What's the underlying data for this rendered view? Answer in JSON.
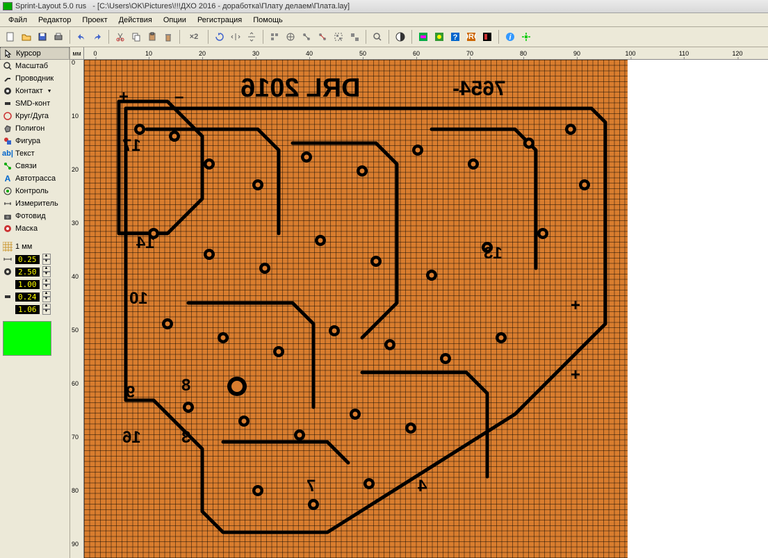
{
  "title": {
    "app": "Sprint-Layout 5.0 rus",
    "file": "- [C:\\Users\\OK\\Pictures\\!!!ДХО 2016 - доработка\\Плату делаем\\Плата.lay]"
  },
  "menu": [
    "Файл",
    "Редактор",
    "Проект",
    "Действия",
    "Опции",
    "Регистрация",
    "Помощь"
  ],
  "tools": [
    {
      "id": "cursor",
      "label": "Курсор",
      "selected": true
    },
    {
      "id": "zoom",
      "label": "Масштаб"
    },
    {
      "id": "track",
      "label": "Проводник"
    },
    {
      "id": "pad",
      "label": "Контакт"
    },
    {
      "id": "smd",
      "label": "SMD-конт"
    },
    {
      "id": "circle",
      "label": "Круг/Дуга"
    },
    {
      "id": "polygon",
      "label": "Полигон"
    },
    {
      "id": "shape",
      "label": "Фигура"
    },
    {
      "id": "text",
      "label": "Текст"
    },
    {
      "id": "connection",
      "label": "Связи"
    },
    {
      "id": "autoroute",
      "label": "Автотрасса"
    },
    {
      "id": "control",
      "label": "Контроль"
    },
    {
      "id": "measure",
      "label": "Измеритель"
    },
    {
      "id": "photoview",
      "label": "Фотовид"
    },
    {
      "id": "mask",
      "label": "Маска"
    }
  ],
  "props": {
    "grid_label": "1 мм",
    "v1": "0.25",
    "v2": "2.50",
    "v3": "1.00",
    "v4": "0.24",
    "v5": "1.06"
  },
  "ruler": {
    "unit": "мм",
    "h_marks": [
      0,
      10,
      20,
      30,
      40,
      50,
      60,
      70,
      80,
      90,
      100,
      110,
      120
    ],
    "v_marks": [
      0,
      10,
      20,
      30,
      40,
      50,
      60,
      70,
      80,
      90
    ]
  },
  "pcb": {
    "labels": {
      "title": "DRL 2016",
      "minus": "7654-",
      "l17": "17",
      "l14": "14",
      "l13": "13",
      "l10": "10",
      "l9": "9",
      "l8": "8",
      "l16": "16",
      "l3": "3",
      "l7": "7",
      "l4": "4",
      "lplus1": "+",
      "lminus1": "–",
      "lplus2": "+",
      "lplus3": "+"
    }
  },
  "swatch_color": "#00ff00"
}
